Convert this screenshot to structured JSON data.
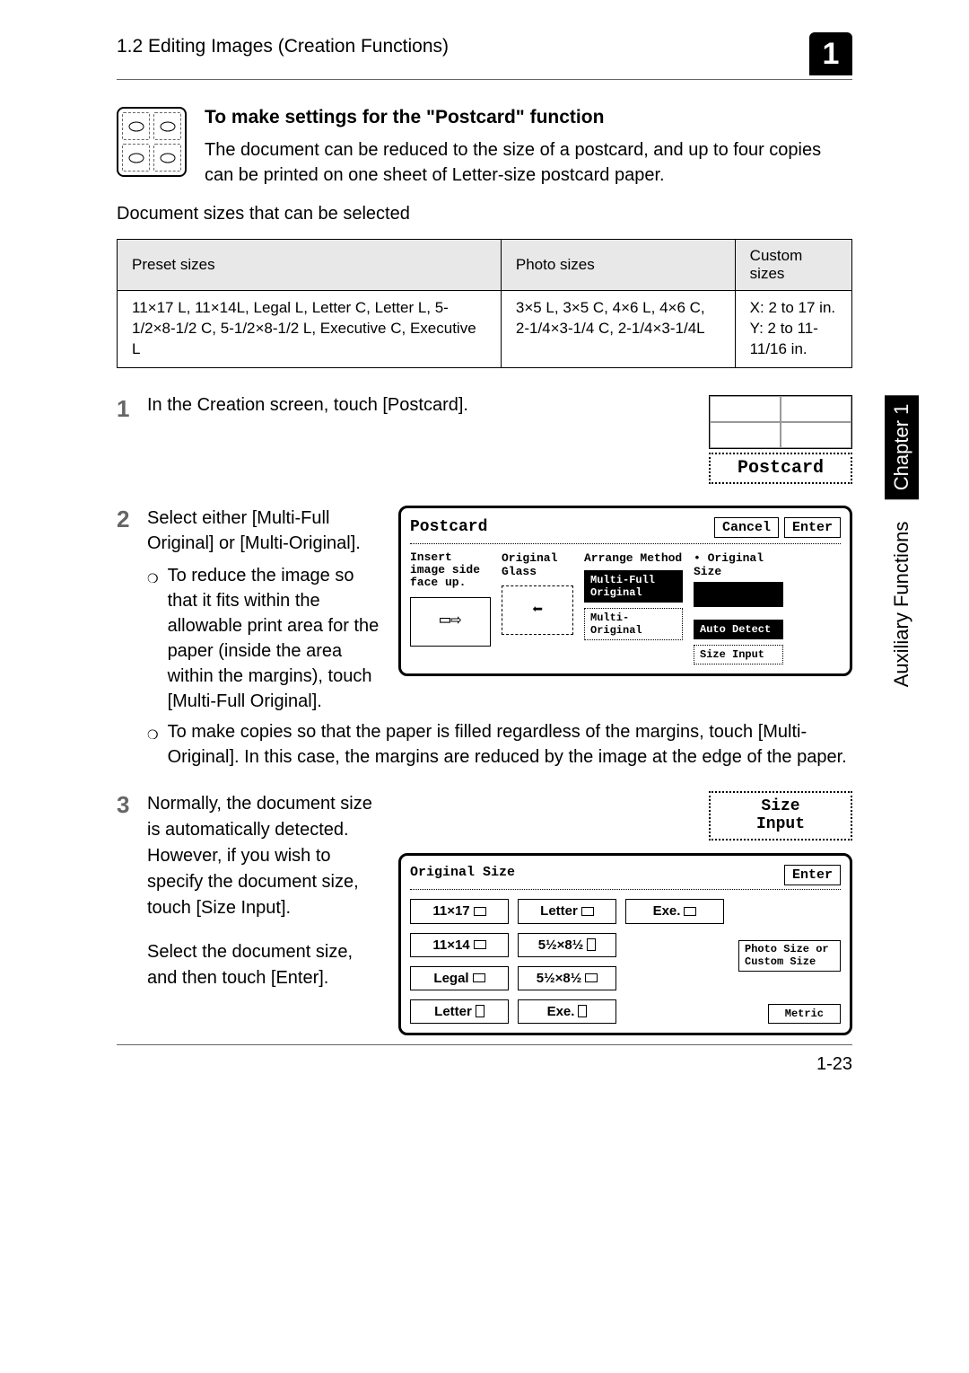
{
  "header": {
    "title": "1.2 Editing Images (Creation Functions)",
    "badge": "1"
  },
  "intro": {
    "heading": "To make settings for the \"Postcard\" function",
    "para": "The document can be reduced to the size of a postcard, and up to four copies can be printed on one sheet of Letter-size postcard paper."
  },
  "doc_sizes_label": "Document sizes that can be selected",
  "table": {
    "headers": [
      "Preset sizes",
      "Photo sizes",
      "Custom sizes"
    ],
    "row": [
      "11×17 L, 11×14L, Legal L, Letter C, Letter L, 5-1/2×8-1/2 C, 5-1/2×8-1/2 L, Executive C, Executive L",
      "3×5 L, 3×5 C, 4×6 L, 4×6 C, 2-1/4×3-1/4 C, 2-1/4×3-1/4L",
      "X: 2 to 17 in.\nY: 2 to 11-11/16 in."
    ]
  },
  "steps": {
    "s1": {
      "num": "1",
      "text": "In the Creation screen, touch [Postcard]."
    },
    "s2": {
      "num": "2",
      "lead": "Select either [Multi-Full Original] or [Multi-Original].",
      "b1": "To reduce the image so that it fits within the allowable print area for the paper (inside the area within the margins), touch [Multi-Full Original].",
      "b2": "To make copies so that the paper is filled regardless of the margins, touch [Multi-Original]. In this case, the margins are reduced by the image at the edge of the paper."
    },
    "s3": {
      "num": "3",
      "p1": "Normally, the document size is automatically detected. However, if you wish to specify the document size, touch [Size Input].",
      "p2": "Select the document size, and then touch [Enter]."
    }
  },
  "ts": {
    "postcard_small": "Postcard",
    "panel1": {
      "title": "Postcard",
      "cancel": "Cancel",
      "enter": "Enter",
      "insert": "Insert image side face up.",
      "orig_glass": "Original Glass",
      "arrange": "Arrange Method",
      "orig_size": "Original Size",
      "multi_full": "Multi-Full Original",
      "multi_orig": "Multi-Original",
      "auto_detect": "Auto Detect",
      "size_input": "Size Input"
    },
    "panel2": {
      "size_input_top": "Size\nInput",
      "title": "Original Size",
      "enter": "Enter",
      "sizes": [
        "11×17",
        "Letter",
        "Exe.",
        "11×14",
        "5½×8½",
        "Legal",
        "5½×8½",
        "Letter",
        "Exe."
      ],
      "photo_custom": "Photo Size or Custom Size",
      "metric": "Metric"
    }
  },
  "side": {
    "chapter": "Chapter 1",
    "aux": "Auxiliary Functions"
  },
  "footer": "1-23"
}
